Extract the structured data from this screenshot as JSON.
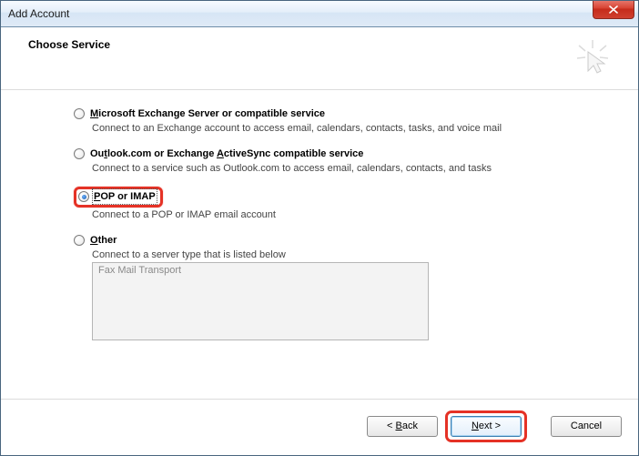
{
  "window": {
    "title": "Add Account"
  },
  "header": {
    "title": "Choose Service"
  },
  "options": {
    "exchange": {
      "label_pre": "",
      "label_ul": "M",
      "label_post": "icrosoft Exchange Server or compatible service",
      "desc": "Connect to an Exchange account to access email, calendars, contacts, tasks, and voice mail"
    },
    "outlookcom": {
      "label_pre": "Ou",
      "label_ul": "t",
      "label_mid": "look.com or Exchange ",
      "label_ul2": "A",
      "label_post": "ctiveSync compatible service",
      "desc": "Connect to a service such as Outlook.com to access email, calendars, contacts, and tasks"
    },
    "pop": {
      "label_ul": "P",
      "label_post": "OP or IMAP",
      "desc": "Connect to a POP or IMAP email account"
    },
    "other": {
      "label_ul": "O",
      "label_post": "ther",
      "desc": "Connect to a server type that is listed below",
      "list_item": "Fax Mail Transport"
    }
  },
  "footer": {
    "back_pre": "< ",
    "back_ul": "B",
    "back_post": "ack",
    "next_ul": "N",
    "next_post": "ext >",
    "cancel": "Cancel"
  }
}
